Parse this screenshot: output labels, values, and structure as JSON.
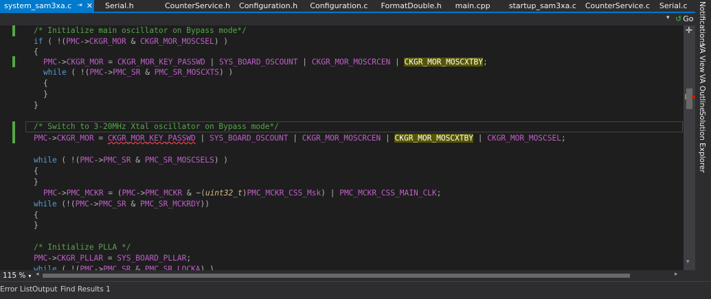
{
  "tabs": [
    {
      "label": "system_sam3xa.c",
      "active": true,
      "pin_icon": "pin-icon",
      "close_icon": "close-icon"
    },
    {
      "label": "Serial.h"
    },
    {
      "label": "CounterService.h"
    },
    {
      "label": "Configuration.h"
    },
    {
      "label": "Configuration.c"
    },
    {
      "label": "FormatDouble.h"
    },
    {
      "label": "main.cpp"
    },
    {
      "label": "startup_sam3xa.c"
    },
    {
      "label": "CounterService.c"
    },
    {
      "label": "Serial.c"
    }
  ],
  "navbar": {
    "go_label": "Go",
    "go_icon": "go-icon"
  },
  "side_panel": [
    "Notifications",
    "VA View",
    "VA Outline",
    "Solution Explorer"
  ],
  "zoom": {
    "value": "115 %"
  },
  "bottom_tabs": [
    "Error List",
    "Output",
    "Find Results 1"
  ],
  "code": {
    "l1": [
      "/* Initialize main oscillator on Bypass mode*/"
    ],
    "l2": [
      "if",
      " ( !(",
      "PMC",
      "->",
      "CKGR_MOR",
      " & ",
      "CKGR_MOR_MOSCSEL",
      ") )"
    ],
    "l3": [
      "{"
    ],
    "l4": [
      "PMC",
      "->",
      "CKGR_MOR",
      " = ",
      "CKGR_MOR_KEY_PASSWD",
      " | ",
      "SYS_BOARD_OSCOUNT",
      " | ",
      "CKGR_MOR_MOSCRCEN",
      " | ",
      "CKGR_MOR_MOSCXTBY",
      ";"
    ],
    "l5": [
      "while",
      " ( !(",
      "PMC",
      "->",
      "PMC_SR",
      " & ",
      "PMC_SR_MOSCXTS",
      ") )"
    ],
    "l6": [
      "{"
    ],
    "l7": [
      "}"
    ],
    "l8": [
      "}"
    ],
    "l9": [
      "/* Switch to 3-20MHz Xtal oscillator on Bypass mode*/"
    ],
    "l10": [
      "PMC",
      "->",
      "CKGR_MOR",
      " = ",
      "CKGR_MOR_KEY_PASSWD",
      " | ",
      "SYS_BOARD_OSCOUNT",
      " | ",
      "CKGR_MOR_MOSCRCEN",
      " | ",
      "CKGR_MOR_MOSCXTBY",
      " | ",
      "CKGR_MOR_MOSCSEL",
      ";"
    ],
    "l11": [
      "while",
      " ( !(",
      "PMC",
      "->",
      "PMC_SR",
      " & ",
      "PMC_SR_MOSCSELS",
      ") )"
    ],
    "l12": [
      "{"
    ],
    "l13": [
      "}"
    ],
    "l14": [
      "PMC",
      "->",
      "PMC_MCKR",
      " = (",
      "PMC",
      "->",
      "PMC_MCKR",
      " & ~(",
      "uint32_t",
      ")",
      "PMC_MCKR_CSS_Msk",
      ") | ",
      "PMC_MCKR_CSS_MAIN_CLK",
      ";"
    ],
    "l15": [
      "while",
      " (!(",
      "PMC",
      "->",
      "PMC_SR",
      " & ",
      "PMC_SR_MCKRDY",
      "))"
    ],
    "l16": [
      "{"
    ],
    "l17": [
      "}"
    ],
    "l18": [
      "/* Initialize PLLA */"
    ],
    "l19": [
      "PMC",
      "->",
      "CKGR_PLLAR",
      " = ",
      "SYS_BOARD_PLLAR",
      ";"
    ],
    "l20": [
      "while",
      " ( !(",
      "PMC",
      "->",
      "PMC_SR",
      " & ",
      "PMC_SR_LOCKA",
      ") )"
    ]
  }
}
